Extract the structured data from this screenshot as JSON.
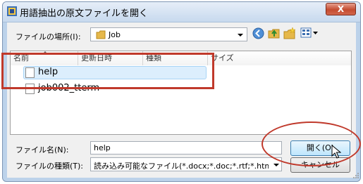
{
  "window": {
    "title": "用語抽出の原文ファイルを開く",
    "close_label": "X"
  },
  "location": {
    "label": "ファイルの場所(I):",
    "value": "Job"
  },
  "toolbar": {
    "icons": [
      "back-icon",
      "up-folder-icon",
      "new-folder-icon",
      "view-menu-icon"
    ]
  },
  "list": {
    "columns": [
      "名前",
      "更新日時",
      "種類",
      "サイズ"
    ],
    "files": [
      {
        "name": "help",
        "selected": true
      },
      {
        "name": "job002_tterm",
        "selected": false
      }
    ]
  },
  "filename": {
    "label": "ファイル名(N):",
    "value": "help"
  },
  "filetype": {
    "label": "ファイルの種類(T):",
    "value": "読み込み可能なファイル(*.docx;*.doc;*.rtf;*.htm;*.h"
  },
  "buttons": {
    "open": "開く(O)",
    "cancel": "キャンセル"
  },
  "colors": {
    "annotation": "#c0392b",
    "selection": "#dceefd"
  }
}
